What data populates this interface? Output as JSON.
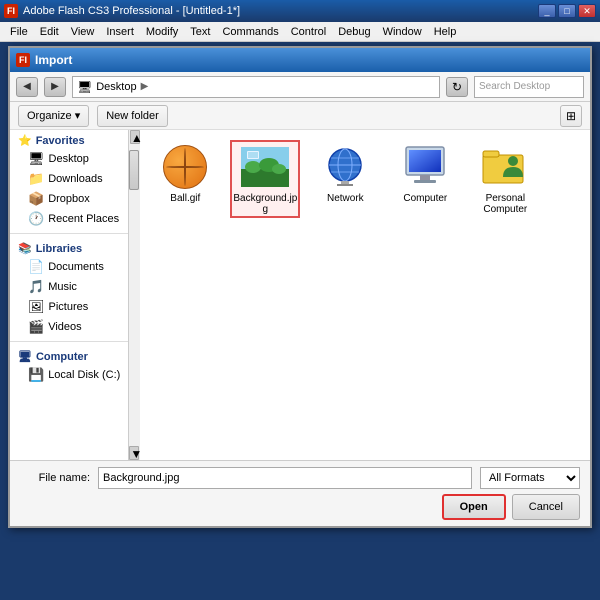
{
  "app": {
    "title": "Adobe Flash CS3 Professional - [Untitled-1*]",
    "icon_label": "FI",
    "menu_items": [
      "File",
      "Edit",
      "View",
      "Insert",
      "Modify",
      "Text",
      "Commands",
      "Control",
      "Debug",
      "Window",
      "Help"
    ]
  },
  "dialog": {
    "title": "Import",
    "address": {
      "location": "Desktop",
      "search_placeholder": "Search Desktop"
    },
    "toolbar": {
      "organize_label": "Organize ▾",
      "new_folder_label": "New folder"
    },
    "sidebar": {
      "favorites_label": "Favorites",
      "items_favorites": [
        {
          "label": "Desktop",
          "icon": "🖥"
        },
        {
          "label": "Downloads",
          "icon": "📥"
        },
        {
          "label": "Dropbox",
          "icon": "📦"
        },
        {
          "label": "Recent Places",
          "icon": "🕐"
        }
      ],
      "libraries_label": "Libraries",
      "items_libraries": [
        {
          "label": "Documents",
          "icon": "📄"
        },
        {
          "label": "Music",
          "icon": "🎵"
        },
        {
          "label": "Pictures",
          "icon": "🖼"
        },
        {
          "label": "Videos",
          "icon": "🎬"
        }
      ],
      "computer_label": "Computer",
      "items_computer": [
        {
          "label": "Local Disk (C:)",
          "icon": "💾"
        }
      ]
    },
    "files": [
      {
        "name": "Ball.gif",
        "type": "basketball",
        "selected": false
      },
      {
        "name": "Background.jpg",
        "type": "image",
        "selected": true
      },
      {
        "name": "Network",
        "type": "network",
        "selected": false
      },
      {
        "name": "Computer",
        "type": "computer",
        "selected": false
      },
      {
        "name": "Personal Computer",
        "type": "personal-computer",
        "selected": false
      }
    ],
    "bottom": {
      "filename_label": "File name:",
      "filename_value": "Background.jpg",
      "format_label": "All Formats",
      "open_label": "Open",
      "cancel_label": "C..."
    }
  }
}
